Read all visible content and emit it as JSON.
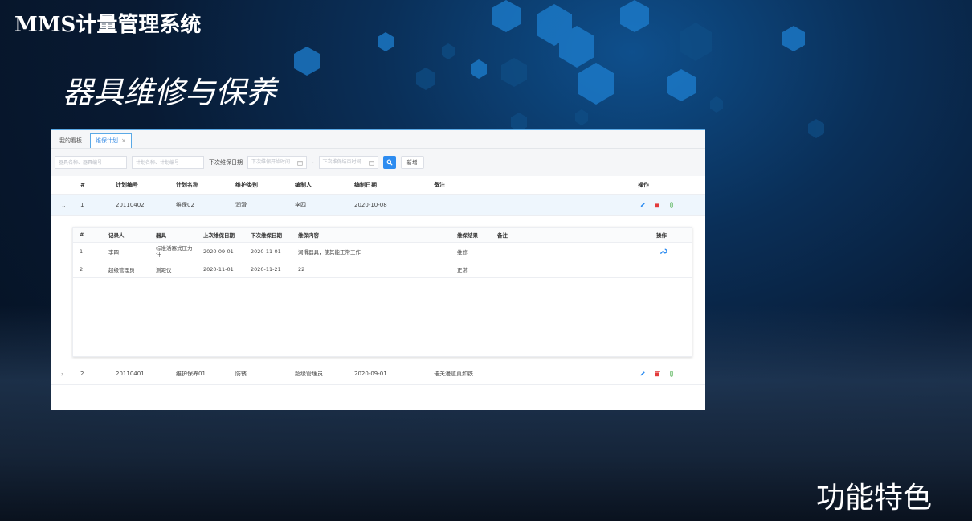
{
  "deck": {
    "title": "MMS计量管理系统",
    "section_title": "器具维修与保养",
    "feature_label": "功能特色"
  },
  "app": {
    "tabs": [
      {
        "label": "我的看板",
        "active": false
      },
      {
        "label": "维保计划",
        "active": true,
        "close": "×"
      }
    ],
    "filters": {
      "instrument_placeholder": "器具名称、器具编号",
      "plan_placeholder": "计划名称、计划编号",
      "next_date_label": "下次维保日期",
      "start_placeholder": "下次维保开始时间",
      "range_sep": "-",
      "end_placeholder": "下次维保结束时间",
      "add_label": "新增"
    },
    "main_columns": [
      "#",
      "计划编号",
      "计划名称",
      "维护类别",
      "编制人",
      "编制日期",
      "备注",
      "操作"
    ],
    "plans": [
      {
        "index": "1",
        "code": "20110402",
        "name": "维保02",
        "category": "润滑",
        "author": "李四",
        "date": "2020-10-08",
        "remark": "",
        "expanded": true,
        "expander": "⌄"
      },
      {
        "index": "2",
        "code": "20110401",
        "name": "维护保养01",
        "category": "防锈",
        "author": "超级管理员",
        "date": "2020-09-01",
        "remark": "璀关漫道真如铁",
        "expanded": false,
        "expander": "›"
      }
    ],
    "sub_columns": [
      "#",
      "记录人",
      "器具",
      "上次维保日期",
      "下次维保日期",
      "维保内容",
      "维保结果",
      "备注",
      "操作"
    ],
    "sub_records": [
      {
        "index": "1",
        "recorder": "李四",
        "instrument": "标准活塞式压力计",
        "last_date": "2020-09-01",
        "next_date": "2020-11-01",
        "content": "润滑器具，使其能正常工作",
        "result": "维修",
        "remark": ""
      },
      {
        "index": "2",
        "recorder": "超级管理员",
        "instrument": "测距仪",
        "last_date": "2020-11-01",
        "next_date": "2020-11-21",
        "content": "22",
        "result": "正常",
        "remark": ""
      }
    ],
    "colors": {
      "accent": "#2d8cf0",
      "delete": "#e33b3b",
      "attach": "#58b45a"
    }
  }
}
